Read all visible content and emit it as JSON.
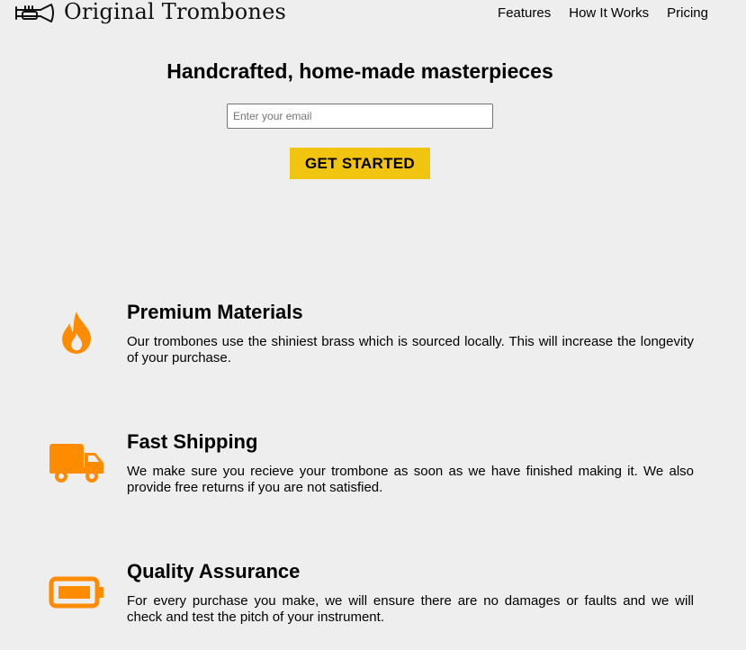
{
  "header": {
    "brand_name": "Original Trombones",
    "logo_icon": "trumpet-logo-icon",
    "nav": [
      {
        "label": "Features"
      },
      {
        "label": "How It Works"
      },
      {
        "label": "Pricing"
      }
    ]
  },
  "hero": {
    "title": "Handcrafted, home-made masterpieces",
    "email_placeholder": "Enter your email",
    "email_value": "",
    "cta_label": "GET STARTED"
  },
  "features": [
    {
      "icon": "fire-icon",
      "title": "Premium Materials",
      "description": "Our trombones use the shiniest brass which is sourced locally. This will increase the longevity of your purchase."
    },
    {
      "icon": "truck-icon",
      "title": "Fast Shipping",
      "description": "We make sure you recieve your trombone as soon as we have finished making it. We also provide free returns if you are not satisfied."
    },
    {
      "icon": "battery-icon",
      "title": "Quality Assurance",
      "description": "For every purchase you make, we will ensure there are no damages or faults and we will check and test the pitch of your instrument."
    }
  ],
  "colors": {
    "background": "#eeeeee",
    "accent": "#f1c40f",
    "icon": "#ff8c00"
  }
}
